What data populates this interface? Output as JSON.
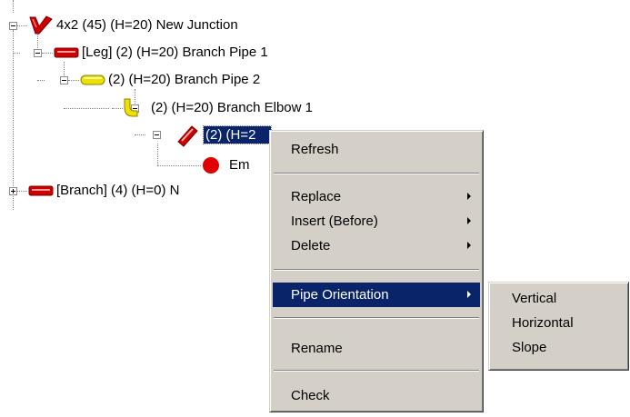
{
  "tree": {
    "nodes": [
      {
        "id": "junction",
        "label": "4x2 (45)  (H=20) New Junction",
        "icon": "junction-icon",
        "color": "#cc0000"
      },
      {
        "id": "leg",
        "label": "[Leg] (2) (H=20) Branch Pipe 1",
        "icon": "red-pipe-icon",
        "color": "#cc0000"
      },
      {
        "id": "pipe2",
        "label": "(2) (H=20) Branch Pipe 2",
        "icon": "yellow-pipe-icon",
        "color": "#e8d800"
      },
      {
        "id": "elbow",
        "label": "(2) (H=20) Branch Elbow 1",
        "icon": "elbow-icon",
        "color": "#e8d800"
      },
      {
        "id": "selected",
        "label": "(2) (H=2",
        "icon": "diagonal-pipe-icon",
        "color": "#cc0000"
      },
      {
        "id": "end",
        "label": "Em",
        "icon": "red-circle-icon",
        "color": "#e00000"
      },
      {
        "id": "branch",
        "label": "[Branch] (4) (H=0) N",
        "icon": "red-pipe-icon",
        "color": "#cc0000"
      }
    ]
  },
  "context_menu": {
    "items": {
      "refresh": "Refresh",
      "replace": "Replace",
      "insert_before": "Insert (Before)",
      "delete": "Delete",
      "pipe_orientation": "Pipe Orientation",
      "rename": "Rename",
      "check": "Check"
    },
    "highlight_color": "#0a246a"
  },
  "submenu": {
    "items": {
      "vertical": "Vertical",
      "horizontal": "Horizontal",
      "slope": "Slope"
    }
  }
}
